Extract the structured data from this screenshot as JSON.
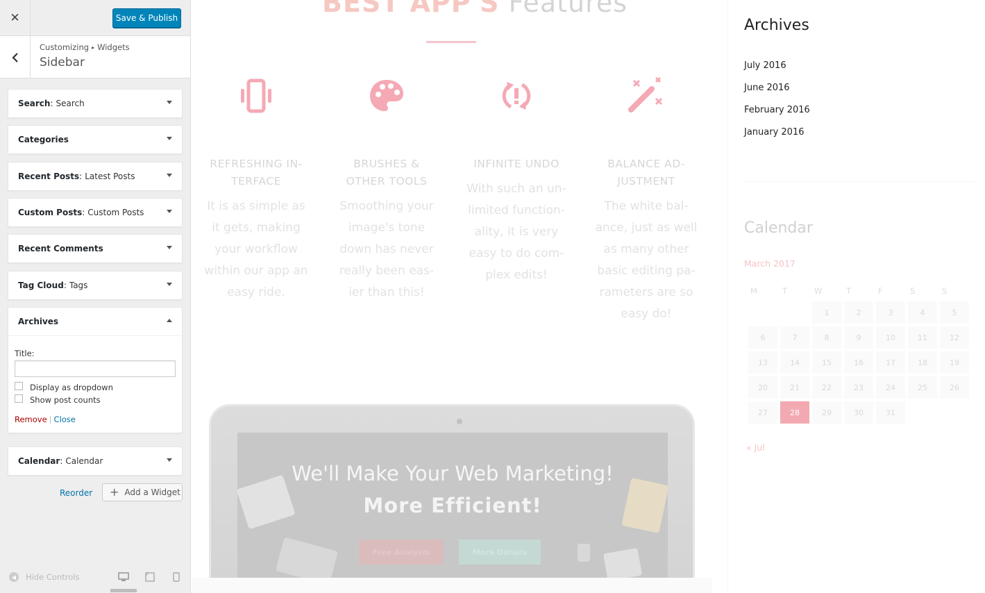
{
  "customizer": {
    "close_icon": "close-icon",
    "save_label": "Save & Publish",
    "breadcrumb": {
      "part1": "Customizing",
      "part2": "Widgets"
    },
    "section_title": "Sidebar",
    "widgets": [
      {
        "name": "Search",
        "title": "Search"
      },
      {
        "name": "Categories",
        "title": ""
      },
      {
        "name": "Recent Posts",
        "title": "Latest Posts"
      },
      {
        "name": "Custom Posts",
        "title": "Custom Posts"
      },
      {
        "name": "Recent Comments",
        "title": ""
      },
      {
        "name": "Tag Cloud",
        "title": "Tags"
      },
      {
        "name": "Archives",
        "title": ""
      },
      {
        "name": "Calendar",
        "title": "Calendar"
      }
    ],
    "archives_form": {
      "title_label": "Title:",
      "title_value": "",
      "dropdown_label": "Display as dropdown",
      "dropdown_checked": false,
      "counts_label": "Show post counts",
      "counts_checked": false,
      "remove_label": "Remove",
      "separator": "|",
      "close_label": "Close"
    },
    "reorder_label": "Reorder",
    "add_widget_label": "Add a Widget",
    "hide_controls_label": "Hide Controls",
    "colors": {
      "primary": "#0085ba",
      "remove": "#aa0000",
      "link": "#0073aa"
    }
  },
  "preview": {
    "hero": {
      "bold": "BEST APP'S",
      "light": "Features"
    },
    "features": [
      {
        "icon": "vibrating-phone-icon",
        "title_l1": "REFRESHING IN-",
        "title_l2": "TERFACE",
        "desc": [
          "It is as simple as",
          "it gets, making",
          "your workflow",
          "within our app an",
          "easy ride."
        ]
      },
      {
        "icon": "palette-icon",
        "title_l1": "BRUSHES &",
        "title_l2": "OTHER TOOLS",
        "desc": [
          "Smoothing your",
          "image's tone",
          "down has never",
          "really been eas-",
          "ier than this!"
        ]
      },
      {
        "icon": "undo-refresh-icon",
        "title_l1": "INFINITE UNDO",
        "title_l2": "",
        "desc": [
          "With such an un-",
          "limited function-",
          "ality, it is very",
          "easy to do com-",
          "plex edits!"
        ]
      },
      {
        "icon": "magic-wand-icon",
        "title_l1": "BALANCE AD-",
        "title_l2": "JUSTMENT",
        "desc": [
          "The white bal-",
          "ance, just as well",
          "as many other",
          "basic editing pa-",
          "rameters are so",
          "easy do!"
        ]
      }
    ],
    "laptop": {
      "heading1": "We'll Make Your Web Marketing!",
      "heading2": "More Efficient!",
      "button1": "Free Analysis",
      "button2": "More Details"
    },
    "archives": {
      "title": "Archives",
      "items": [
        "July 2016",
        "June 2016",
        "February 2016",
        "January 2016"
      ]
    },
    "calendar": {
      "title": "Calendar",
      "month": "March 2017",
      "weekdays": [
        "M",
        "T",
        "W",
        "T",
        "F",
        "S",
        "S"
      ],
      "weeks": [
        [
          "",
          "",
          "1",
          "2",
          "3",
          "4",
          "5"
        ],
        [
          "6",
          "7",
          "8",
          "9",
          "10",
          "11",
          "12"
        ],
        [
          "13",
          "14",
          "15",
          "16",
          "17",
          "18",
          "19"
        ],
        [
          "20",
          "21",
          "22",
          "23",
          "24",
          "25",
          "26"
        ],
        [
          "27",
          "28",
          "29",
          "30",
          "31",
          "",
          ""
        ]
      ],
      "today": "28",
      "prev_link": "« Jul"
    }
  }
}
